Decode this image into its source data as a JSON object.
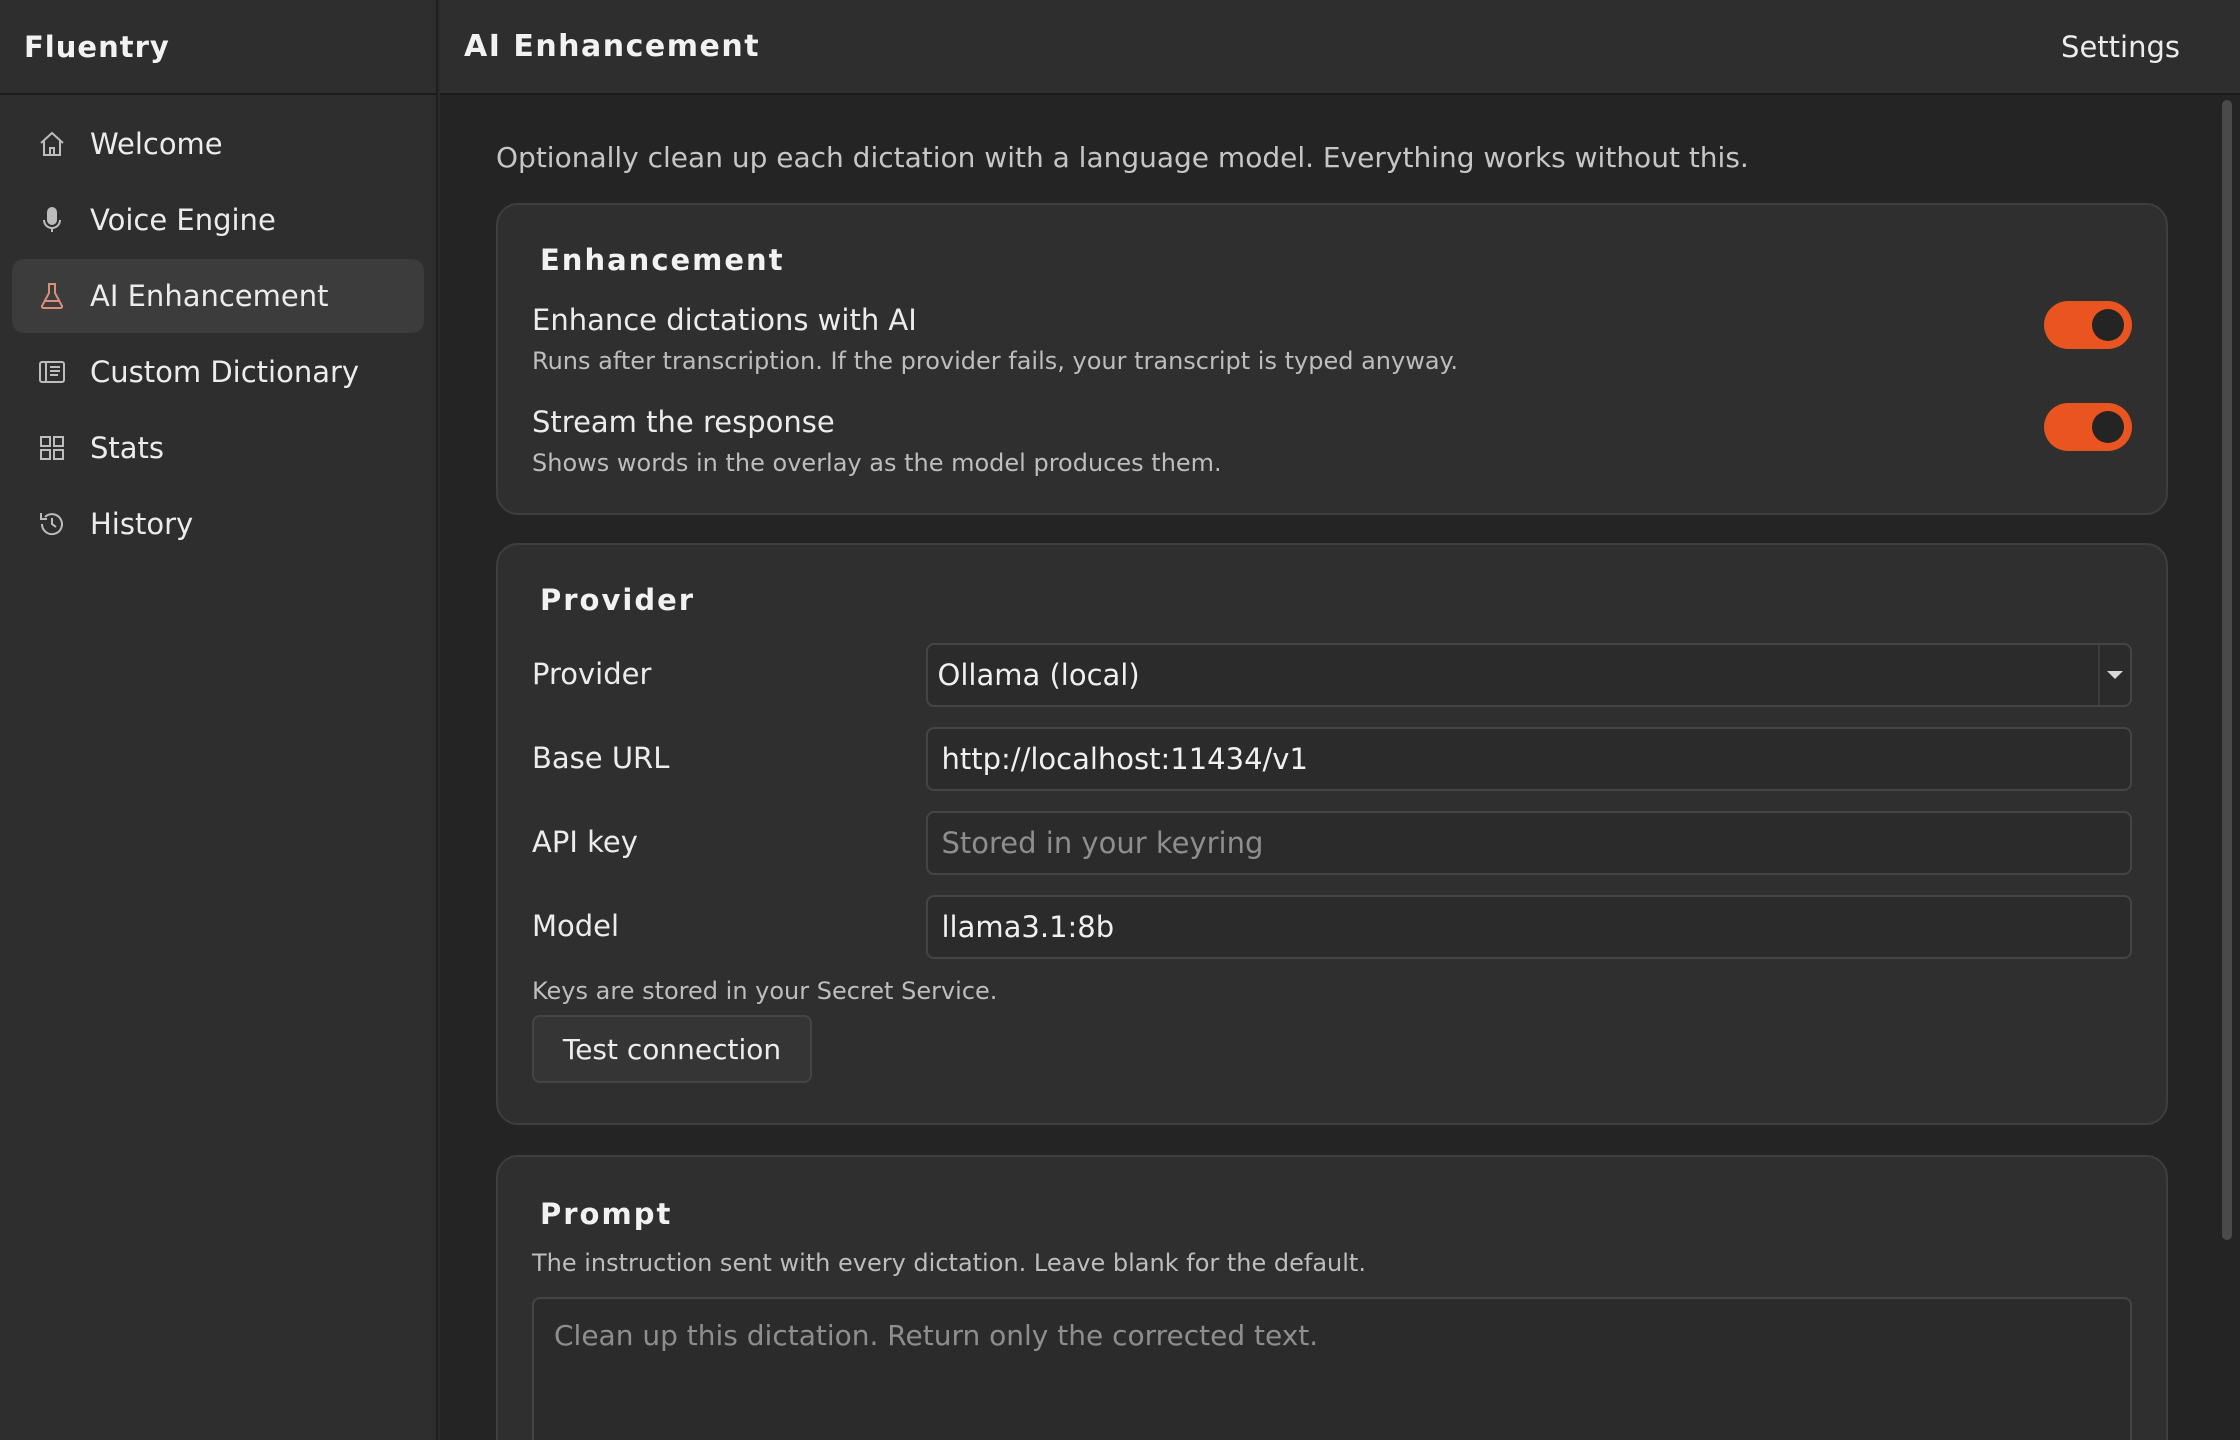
{
  "app": {
    "name": "Fluentry"
  },
  "sidebar": {
    "items": [
      {
        "label": "Welcome",
        "icon": "home-icon",
        "active": false
      },
      {
        "label": "Voice Engine",
        "icon": "microphone-icon",
        "active": false
      },
      {
        "label": "AI Enhancement",
        "icon": "flask-icon",
        "active": true
      },
      {
        "label": "Custom Dictionary",
        "icon": "book-icon",
        "active": false
      },
      {
        "label": "Stats",
        "icon": "grid-icon",
        "active": false
      },
      {
        "label": "History",
        "icon": "history-icon",
        "active": false
      }
    ]
  },
  "header": {
    "title": "AI Enhancement",
    "settings_label": "Settings"
  },
  "intro": "Optionally clean up each dictation with a language model. Everything works without this.",
  "enhancement": {
    "title": "Enhancement",
    "toggles": [
      {
        "title": "Enhance dictations with AI",
        "subtitle": "Runs after transcription. If the provider fails, your transcript is typed anyway.",
        "on": true
      },
      {
        "title": "Stream the response",
        "subtitle": "Shows words in the overlay as the model produces them.",
        "on": true
      }
    ]
  },
  "provider": {
    "title": "Provider",
    "provider_label": "Provider",
    "provider_value": "Ollama (local)",
    "base_url_label": "Base URL",
    "base_url_value": "http://localhost:11434/v1",
    "api_key_label": "API key",
    "api_key_placeholder": "Stored in your keyring",
    "model_label": "Model",
    "model_value": "llama3.1:8b",
    "note": "Keys are stored in your Secret Service.",
    "test_button": "Test connection"
  },
  "prompt": {
    "title": "Prompt",
    "description": "The instruction sent with every dictation. Leave blank for the default.",
    "placeholder": "Clean up this dictation. Return only the corrected text."
  },
  "colors": {
    "accent": "#e95420",
    "background": "#242424",
    "card": "#2f2f2f"
  }
}
